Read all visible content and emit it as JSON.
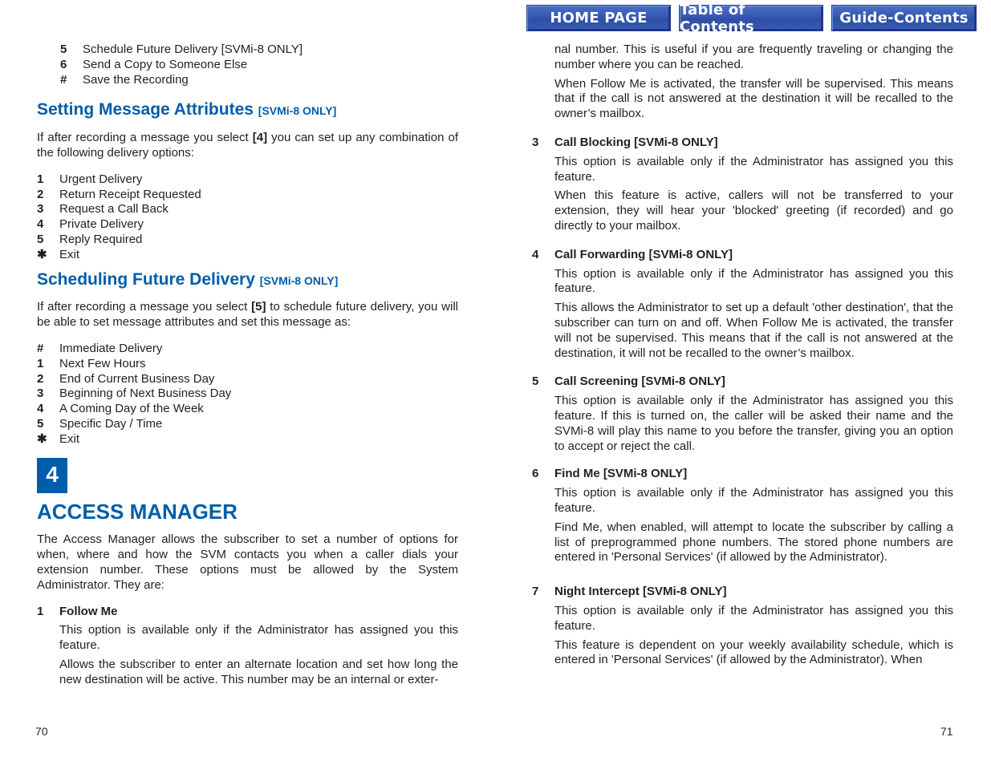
{
  "nav": {
    "home": "HOME PAGE",
    "toc": "Table of Contents",
    "guide": "Guide-Contents"
  },
  "left": {
    "top_list": [
      {
        "key": "5",
        "text": "Schedule Future Delivery [SVMi-8 ONLY]"
      },
      {
        "key": "6",
        "text": "Send a Copy to Someone Else"
      },
      {
        "key": "#",
        "text": "Save the Recording"
      }
    ],
    "attributes": {
      "title": "Setting Message Attributes",
      "tag": "[SVMi-8 ONLY]",
      "intro_pre": "If after recording a message you select ",
      "intro_key": "[4]",
      "intro_post": " you can set up any combination of the following delivery options:",
      "items": [
        {
          "key": "1",
          "text": "Urgent Delivery"
        },
        {
          "key": "2",
          "text": "Return Receipt Requested"
        },
        {
          "key": "3",
          "text": "Request a Call Back"
        },
        {
          "key": "4",
          "text": "Private Delivery"
        },
        {
          "key": "5",
          "text": "Reply Required"
        },
        {
          "key": "✱",
          "text": "Exit"
        }
      ]
    },
    "scheduling": {
      "title": "Scheduling Future Delivery",
      "tag": "[SVMi-8 ONLY]",
      "intro_pre": "If after recording a message you select ",
      "intro_key": "[5]",
      "intro_post": " to schedule future delivery, you will be able to set message attributes and set this message as:",
      "items": [
        {
          "key": "#",
          "text": "Immediate Delivery"
        },
        {
          "key": "1",
          "text": "Next Few Hours"
        },
        {
          "key": "2",
          "text": "End of Current Business Day"
        },
        {
          "key": "3",
          "text": "Beginning of Next Business Day"
        },
        {
          "key": "4",
          "text": "A Coming Day of the Week"
        },
        {
          "key": "5",
          "text": "Specific Day / Time"
        },
        {
          "key": "✱",
          "text": "Exit"
        }
      ]
    },
    "chapter": {
      "number": "4",
      "title": "ACCESS MANAGER",
      "intro": "The Access Manager allows the subscriber to set a number of options for when, where and how the SVM contacts you when a caller dials your extension number. These options must be allowed by the System Administrator. They are:",
      "item1": {
        "num": "1",
        "title": "Follow Me",
        "p1": "This option is available only if the Administrator has assigned you this feature.",
        "p2": "Allows the subscriber to enter an alternate location and set how long the new destination will be active. This number may be an internal or exter-"
      }
    },
    "page_number": "70"
  },
  "right": {
    "cont_p1": "nal number. This is useful if you are frequently traveling or changing the number where you can be reached.",
    "cont_p2": "When Follow Me is activated, the transfer will be supervised. This means that if the call is not answered at the destination it will be recalled to the owner’s mailbox.",
    "items": [
      {
        "num": "3",
        "title": "Call Blocking [SVMi-8 ONLY]",
        "p1": "This option is available only if the Administrator has assigned you this feature.",
        "p2": "When this feature is active, callers will not be transferred to your extension, they will hear your 'blocked' greeting (if recorded) and go directly to your mailbox."
      },
      {
        "num": "4",
        "title": "Call Forwarding [SVMi-8 ONLY]",
        "p1": "This option is available only if the Administrator has assigned you this feature.",
        "p2": "This allows the Administrator to set up a default 'other destination', that the subscriber can turn on and off. When Follow Me is activated, the transfer will not be supervised. This means that if the call is not answered at the destination, it will not be recalled to the owner’s mailbox."
      },
      {
        "num": "5",
        "title": "Call Screening [SVMi-8 ONLY]",
        "p1": "This option is available only if the Administrator has assigned you this feature. If this is turned on, the caller will be asked their name and the SVMi-8 will play this name to you before the transfer, giving you an option to accept or reject the call.",
        "p2": ""
      },
      {
        "num": "6",
        "title": "Find Me [SVMi-8 ONLY]",
        "p1": "This option is available only if the Administrator has assigned you this feature.",
        "p2": "Find Me, when enabled, will attempt to locate the subscriber by calling a list of preprogrammed phone numbers. The stored phone numbers are entered in 'Personal Services' (if allowed by the Administrator)."
      },
      {
        "num": "7",
        "title": "Night Intercept [SVMi-8 ONLY]",
        "p1": "This option is available only if the Administrator has assigned you this feature.",
        "p2": "This feature is dependent on your weekly availability schedule, which is entered in 'Personal Services' (if allowed by the Administrator). When"
      }
    ],
    "page_number": "71"
  }
}
